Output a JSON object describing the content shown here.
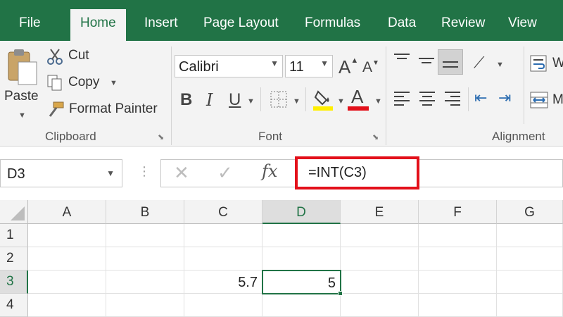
{
  "tabs": [
    {
      "label": "File",
      "active": false
    },
    {
      "label": "Home",
      "active": true
    },
    {
      "label": "Insert",
      "active": false
    },
    {
      "label": "Page Layout",
      "active": false
    },
    {
      "label": "Formulas",
      "active": false
    },
    {
      "label": "Data",
      "active": false
    },
    {
      "label": "Review",
      "active": false
    },
    {
      "label": "View",
      "active": false
    }
  ],
  "ribbon": {
    "clipboard": {
      "paste_label": "Paste",
      "cut_label": "Cut",
      "copy_label": "Copy",
      "format_painter_label": "Format Painter",
      "group_label": "Clipboard"
    },
    "font": {
      "font_name": "Calibri",
      "font_size": "11",
      "bold_label": "B",
      "italic_label": "I",
      "underline_label": "U",
      "grow_label": "A",
      "shrink_label": "A",
      "font_color_label": "A",
      "highlight_color": "#ffef00",
      "font_color": "#e3101a",
      "group_label": "Font"
    },
    "alignment": {
      "wrap_label": "W",
      "merge_label": "M",
      "group_label": "Alignment"
    }
  },
  "formula_bar": {
    "name_box": "D3",
    "cancel_glyph": "✕",
    "enter_glyph": "✓",
    "fx_label": "fx",
    "formula": "=INT(C3)",
    "highlight_color": "#e3101a"
  },
  "sheet": {
    "columns": [
      "A",
      "B",
      "C",
      "D",
      "E",
      "F",
      "G"
    ],
    "rows": [
      "1",
      "2",
      "3",
      "4"
    ],
    "selected_column": "D",
    "selected_row": "3",
    "cells": {
      "C3": "5.7",
      "D3": "5"
    },
    "accent_color": "#217346"
  }
}
